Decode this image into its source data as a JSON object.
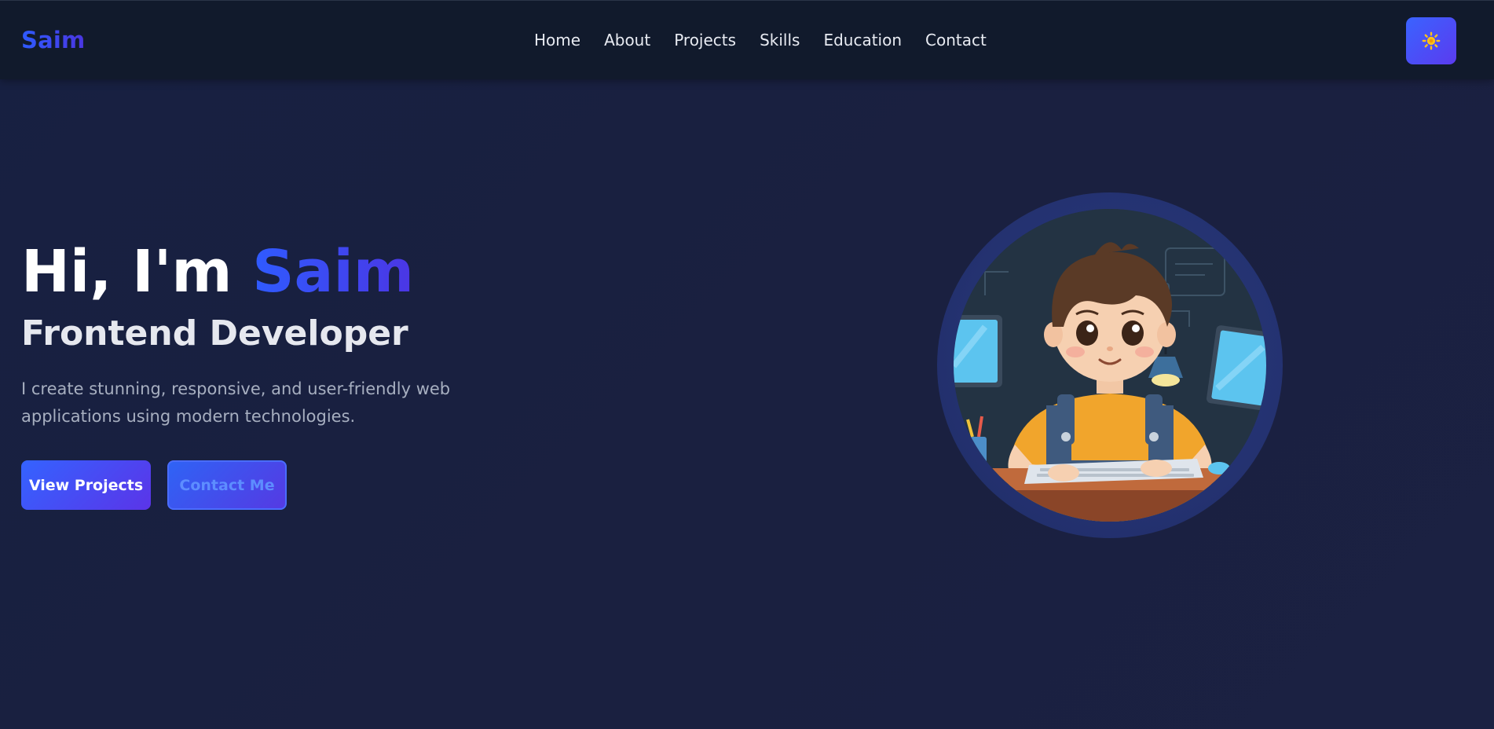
{
  "nav": {
    "logo": "Saim",
    "links": [
      "Home",
      "About",
      "Projects",
      "Skills",
      "Education",
      "Contact"
    ],
    "theme_toggle_icon": "sun-icon"
  },
  "hero": {
    "greeting": "Hi, I'm ",
    "name": "Saim",
    "role": "Frontend Developer",
    "description": "I create stunning, responsive, and user-friendly web applications using modern technologies.",
    "primary_button": "View Projects",
    "secondary_button": "Contact Me"
  },
  "colors": {
    "background": "#1a2040",
    "navbar": "#111a2c",
    "accent_start": "#2e5bff",
    "accent_end": "#4b36e4",
    "sun": "#ffc21a"
  }
}
